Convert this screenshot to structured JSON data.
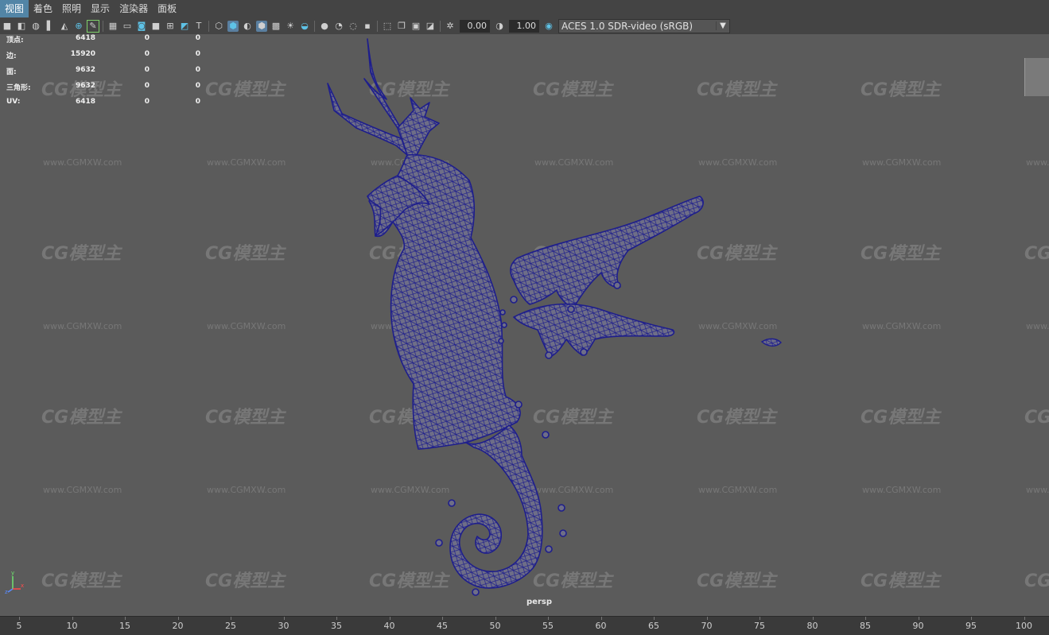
{
  "menu": {
    "items": [
      {
        "label": "视图",
        "active": true
      },
      {
        "label": "着色",
        "active": false
      },
      {
        "label": "照明",
        "active": false
      },
      {
        "label": "显示",
        "active": false
      },
      {
        "label": "渲染器",
        "active": false
      },
      {
        "label": "面板",
        "active": false
      }
    ]
  },
  "toolbar": {
    "exposure_value": "0.00",
    "gamma_value": "1.00",
    "color_space": "ACES 1.0 SDR-video (sRGB)"
  },
  "hud": {
    "rows": [
      {
        "label": "顶点:",
        "v1": "6418",
        "v2": "0",
        "v3": "0"
      },
      {
        "label": "边:",
        "v1": "15920",
        "v2": "0",
        "v3": "0"
      },
      {
        "label": "面:",
        "v1": "9632",
        "v2": "0",
        "v3": "0"
      },
      {
        "label": "三角形:",
        "v1": "9632",
        "v2": "0",
        "v3": "0"
      },
      {
        "label": "UV:",
        "v1": "6418",
        "v2": "0",
        "v3": "0"
      }
    ]
  },
  "viewport": {
    "camera_label": "persp",
    "watermark_logo": "CG模型主",
    "watermark_url": "www.CGMXW.com",
    "axis": {
      "x": "x",
      "y": "y",
      "z": "z"
    }
  },
  "timeline": {
    "ticks": [
      "5",
      "10",
      "15",
      "20",
      "25",
      "30",
      "35",
      "40",
      "45",
      "50",
      "55",
      "60",
      "65",
      "70",
      "75",
      "80",
      "85",
      "90",
      "95",
      "100"
    ]
  },
  "colors": {
    "menu_active": "#5285a6",
    "viewport_bg": "#5b5b5b",
    "wireframe": "#1e1e8c",
    "mesh_fill": "#6f6f86"
  }
}
